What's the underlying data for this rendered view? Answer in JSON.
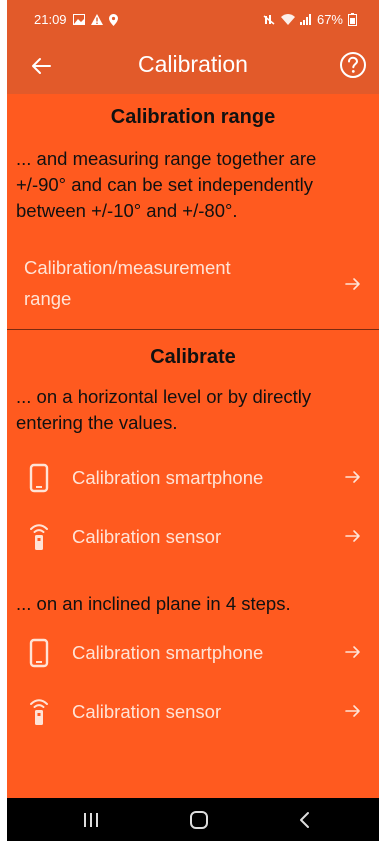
{
  "status_bar": {
    "time": "21:09",
    "battery": "67%"
  },
  "app_bar": {
    "title": "Calibration"
  },
  "section_range": {
    "heading": "Calibration range",
    "description": "... and measuring range together are +/-90° and can be set independently between +/-10° and +/-80°.",
    "link_line1": "Calibration/measurement",
    "link_line2": "range"
  },
  "section_calibrate": {
    "heading": "Calibrate",
    "horizontal_text": "... on a horizontal level or by directly entering the values.",
    "inclined_text": "... on an inclined plane in 4 steps.",
    "horizontal_smartphone": "Calibration smartphone",
    "horizontal_sensor": "Calibration sensor",
    "inclined_smartphone": "Calibration smartphone",
    "inclined_sensor": "Calibration sensor"
  },
  "colors": {
    "statusbar": "#e25a2a",
    "content": "#ff5a1f",
    "link_text": "#ffe3d6"
  }
}
